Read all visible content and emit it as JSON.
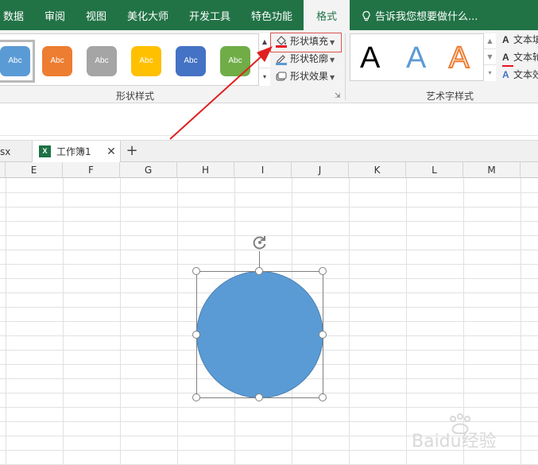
{
  "tabs": [
    {
      "label": "数据"
    },
    {
      "label": "审阅"
    },
    {
      "label": "视图"
    },
    {
      "label": "美化大师"
    },
    {
      "label": "开发工具"
    },
    {
      "label": "特色功能"
    },
    {
      "label": "格式"
    }
  ],
  "tell_me": "告诉我您想要做什么...",
  "shape_styles": {
    "thumb_label": "Abc",
    "colors": [
      "#5b9bd5",
      "#ed7d31",
      "#a5a5a5",
      "#ffc000",
      "#4472c4",
      "#70ad47"
    ],
    "group_label": "形状样式",
    "fill_label": "形状填充",
    "outline_label": "形状轮廓",
    "effect_label": "形状效果"
  },
  "wordart": {
    "group_label": "艺术字样式",
    "glyph": "A",
    "text_fill": "文本填",
    "text_outline": "文本轮",
    "text_effect": "文本效"
  },
  "doc_tabs": {
    "prev_fragment": "sx",
    "current": "工作簿1",
    "current_icon": "X"
  },
  "columns": [
    "E",
    "F",
    "G",
    "H",
    "I",
    "J",
    "K",
    "L",
    "M"
  ],
  "accent": "#217346",
  "shape_color": "#5b9bd5",
  "watermark_text": "Baidu经验"
}
